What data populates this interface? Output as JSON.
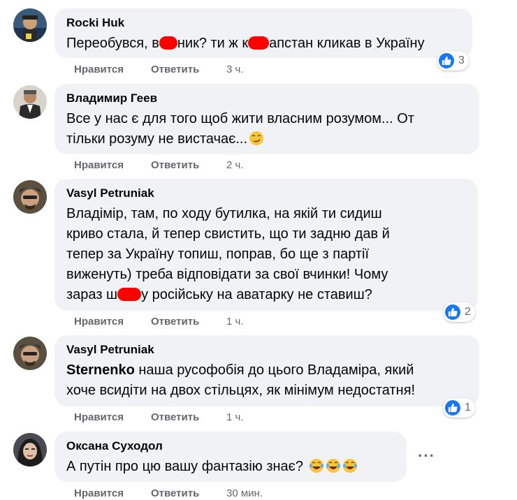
{
  "comments": [
    {
      "author": "Rocki Huk",
      "text_parts": [
        "Переобувся, в",
        "ник? ти ж к",
        "апстан кликав в Україну"
      ],
      "reactions": "3",
      "like_label": "Нравится",
      "reply_label": "Ответить",
      "time": "3 ч."
    },
    {
      "author": "Владимир Геев",
      "text_line1": "Все у нас є для того щоб жити власним розумом... От",
      "text_line2": "тільки розуму не вистачає...",
      "like_label": "Нравится",
      "reply_label": "Ответить",
      "time": "2 ч."
    },
    {
      "author": "Vasyl Petruniak",
      "text_line1": "Владімір, там, по ходу бутилка, на якій ти сидиш",
      "text_line2": "криво стала, й тепер свистить, що ти задню дав й",
      "text_line3": "тепер за Україну топиш, поправ, бо ще з партії",
      "text_line4": "виженуть) треба відповідати за свої вчинки! Чому",
      "text_line5_a": "зараз ш",
      "text_line5_b": "у російську на аватарку не ставиш?",
      "reactions": "2",
      "like_label": "Нравится",
      "reply_label": "Ответить",
      "time": "1 ч."
    },
    {
      "author": "Vasyl Petruniak",
      "mention": "Sternenko",
      "text_line1": " наша русофобія до цього Владаміра, який",
      "text_line2": "хоче всидіти на двох стільцях, як мінімум недостатня!",
      "reactions": "1",
      "like_label": "Нравится",
      "reply_label": "Ответить",
      "time": "1 ч."
    },
    {
      "author": "Оксана Суходол",
      "text": "А путін про цю вашу фантазію знає?",
      "more_label": "···",
      "like_label": "Нравится",
      "reply_label": "Ответить",
      "time": "30 мин."
    }
  ],
  "colors": {
    "bubble": "#f0f2f5",
    "like_blue": "#1877f2",
    "meta_gray": "#65676b",
    "censor_red": "#ff0000"
  },
  "icons": {
    "reaction": "thumbs-up-icon",
    "emoji_smirk": "smirk-emoji-icon",
    "emoji_laugh": "tears-of-joy-emoji-icon",
    "more": "more-dots-icon"
  }
}
